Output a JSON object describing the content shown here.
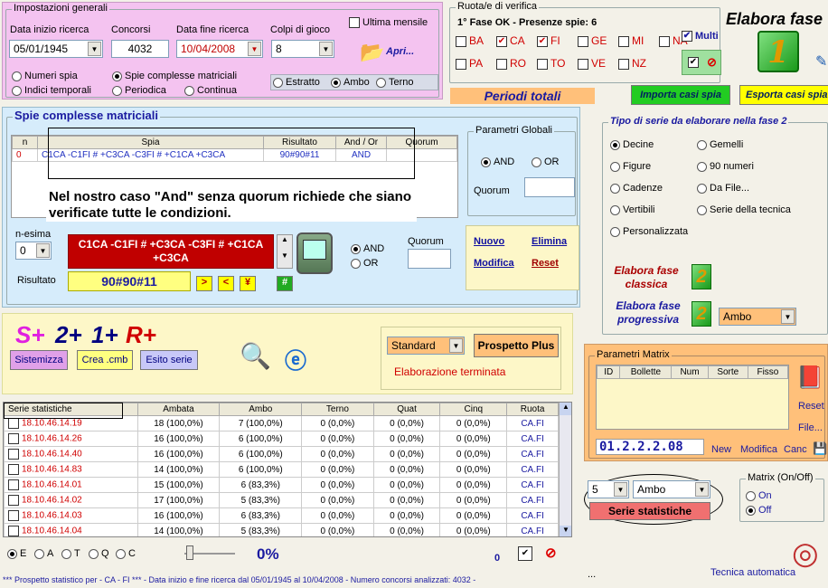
{
  "general": {
    "title": "Impostazioni generali",
    "data_inizio_label": "Data inizio ricerca",
    "data_inizio_value": "05/01/1945",
    "concorsi_label": "Concorsi",
    "concorsi_value": "4032",
    "data_fine_label": "Data fine ricerca",
    "data_fine_value": "10/04/2008",
    "colpi_label": "Colpi di gioco",
    "colpi_value": "8",
    "ultima_mensile": "Ultima mensile",
    "apri": "Apri...",
    "radio_numeri_spia": "Numeri spia",
    "radio_spie_complesse": "Spie complesse matriciali",
    "radio_indici": "Indici temporali",
    "radio_periodica": "Periodica",
    "radio_continua": "Continua",
    "radio_estratto": "Estratto",
    "radio_ambo": "Ambo",
    "radio_terno": "Terno"
  },
  "ruota": {
    "title": "Ruota/e di verifica",
    "status": "1° Fase OK - Presenze spie: 6",
    "wheels_row1": [
      "BA",
      "CA",
      "FI",
      "GE",
      "MI",
      "NA"
    ],
    "wheels_row1_checked": [
      false,
      true,
      true,
      false,
      false,
      false
    ],
    "wheels_row2": [
      "PA",
      "RO",
      "TO",
      "VE",
      "NZ"
    ],
    "multi": "Multi",
    "elabora_fase": "Elabora fase",
    "fase_number": "1"
  },
  "toolbar": {
    "periodi_totali": "Periodi totali",
    "importa": "Importa casi spia",
    "esporta": "Esporta casi spia"
  },
  "spie": {
    "title": "Spie complesse matriciali",
    "columns": [
      "n",
      "Spia",
      "Risultato",
      "And / Or",
      "Quorum"
    ],
    "rows": [
      {
        "n": "0",
        "spia": "C1CA -C1FI # +C3CA -C3FI # +C1CA +C3CA",
        "risultato": "90#90#11",
        "andor": "AND",
        "quorum": ""
      }
    ],
    "note": "Nel nostro caso \"And\" senza quorum richiede che siano verificate tutte le condizioni.",
    "parametri_title": "Parametri Globali",
    "and": "AND",
    "or": "OR",
    "quorum_label": "Quorum",
    "nesima_label": "n-esima",
    "nesima_value": "0",
    "formula": "C1CA -C1FI # +C3CA -C3FI # +C1CA +C3CA",
    "risultato_label": "Risultato",
    "risultato_value": "90#90#11",
    "btn_gt": ">",
    "btn_lt": "<",
    "btn_yen": "¥",
    "btn_hash": "#",
    "nuovo": "Nuovo",
    "elimina": "Elimina",
    "modifica": "Modifica",
    "reset": "Reset"
  },
  "serie": {
    "title": "Tipo di serie da elaborare nella fase 2",
    "options_left": [
      "Decine",
      "Figure",
      "Cadenze",
      "Vertibili",
      "Personalizzata"
    ],
    "options_right": [
      "Gemelli",
      "90 numeri",
      "Da File...",
      "Serie della tecnica"
    ],
    "elabora_classica": "Elabora fase classica",
    "elabora_progressiva": "Elabora fase progressiva",
    "fase2": "2",
    "progressiva_combo": "Ambo"
  },
  "splus": {
    "s": "S+",
    "two": "2+",
    "one": "1+",
    "r": "R+",
    "sistemizza": "Sistemizza",
    "crea_cmb": "Crea .cmb",
    "esito_serie": "Esito serie",
    "standard": "Standard",
    "prospetto_plus": "Prospetto Plus",
    "elaborazione": "Elaborazione terminata"
  },
  "stats": {
    "columns": [
      "Serie statistiche",
      "Ambata",
      "Ambo",
      "Terno",
      "Quat",
      "Cinq",
      "Ruota"
    ],
    "rows": [
      [
        "18.10.46.14.19",
        "18 (100,0%)",
        "7 (100,0%)",
        "0 (0,0%)",
        "0 (0,0%)",
        "0 (0,0%)",
        "CA.FI"
      ],
      [
        "18.10.46.14.26",
        "16 (100,0%)",
        "6 (100,0%)",
        "0 (0,0%)",
        "0 (0,0%)",
        "0 (0,0%)",
        "CA.FI"
      ],
      [
        "18.10.46.14.40",
        "16 (100,0%)",
        "6 (100,0%)",
        "0 (0,0%)",
        "0 (0,0%)",
        "0 (0,0%)",
        "CA.FI"
      ],
      [
        "18.10.46.14.83",
        "14 (100,0%)",
        "6 (100,0%)",
        "0 (0,0%)",
        "0 (0,0%)",
        "0 (0,0%)",
        "CA.FI"
      ],
      [
        "18.10.46.14.01",
        "15 (100,0%)",
        "6 (83,3%)",
        "0 (0,0%)",
        "0 (0,0%)",
        "0 (0,0%)",
        "CA.FI"
      ],
      [
        "18.10.46.14.02",
        "17 (100,0%)",
        "5 (83,3%)",
        "0 (0,0%)",
        "0 (0,0%)",
        "0 (0,0%)",
        "CA.FI"
      ],
      [
        "18.10.46.14.03",
        "16 (100,0%)",
        "6 (83,3%)",
        "0 (0,0%)",
        "0 (0,0%)",
        "0 (0,0%)",
        "CA.FI"
      ],
      [
        "18.10.46.14.04",
        "14 (100,0%)",
        "5 (83,3%)",
        "0 (0,0%)",
        "0 (0,0%)",
        "0 (0,0%)",
        "CA.FI"
      ]
    ]
  },
  "matrix": {
    "title": "Parametri Matrix",
    "columns": [
      "ID",
      "Bollette",
      "Num",
      "Sorte",
      "Fisso"
    ],
    "reset": "Reset",
    "file": "File...",
    "code": "01.2.2.2.08",
    "new": "New",
    "modifica": "Modifica",
    "canc": "Canc",
    "combo_num": "5",
    "combo_sorte": "Ambo",
    "serie_statistiche": "Serie statistiche",
    "onoff_title": "Matrix (On/Off)",
    "on": "On",
    "off": "Off",
    "tecnica": "Tecnica automatica",
    "dots": "..."
  },
  "bottom": {
    "radios": [
      "E",
      "A",
      "T",
      "Q",
      "C"
    ],
    "percent": "0%",
    "zero": "0",
    "status": "*** Prospetto statistico per  - CA - FI ***  - Data inizio e fine ricerca dal 05/01/1945 al 10/04/2008 - Numero concorsi analizzati: 4032 -"
  },
  "colors": {
    "pink": "#f4c3f0",
    "yellow": "#fdf7c8",
    "green": "#22cc22",
    "orange": "#ffc07a",
    "red": "#c00000",
    "blue": "#1a1aa0"
  }
}
